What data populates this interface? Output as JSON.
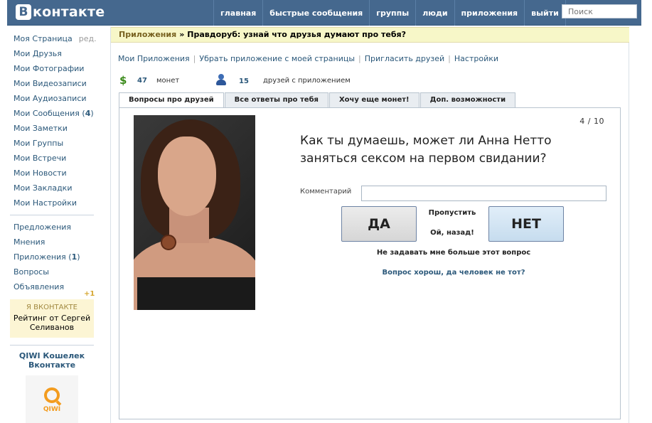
{
  "header": {
    "logo_mark": "В",
    "logo_text": "контакте",
    "nav": [
      "главная",
      "быстрые сообщения",
      "группы",
      "люди",
      "приложения",
      "выйти"
    ],
    "search_placeholder": "Поиск"
  },
  "sidebar": {
    "items": [
      {
        "label": "Моя Страница",
        "extra": "ред."
      },
      {
        "label": "Мои Друзья"
      },
      {
        "label": "Мои Фотографии"
      },
      {
        "label": "Мои Видеозаписи"
      },
      {
        "label": "Мои Аудиозаписи"
      },
      {
        "label": "Мои Сообщения",
        "count": "4"
      },
      {
        "label": "Мои Заметки"
      },
      {
        "label": "Мои Группы"
      },
      {
        "label": "Мои Встречи"
      },
      {
        "label": "Мои Новости"
      },
      {
        "label": "Мои Закладки"
      },
      {
        "label": "Мои Настройки"
      }
    ],
    "items2": [
      {
        "label": "Предложения"
      },
      {
        "label": "Мнения"
      },
      {
        "label": "Приложения",
        "count": "1"
      },
      {
        "label": "Вопросы"
      },
      {
        "label": "Объявления"
      }
    ],
    "plus": "+1",
    "ya_title": "Я ВКОНТАКТЕ",
    "ya_text": "Рейтинг от Сергей Селиванов",
    "qiwi_title": "QIWI Кошелек Вконтакте",
    "qiwi_word": "QIWI"
  },
  "main": {
    "breadcrumb": "Приложения",
    "breadcrumb_sep": "»",
    "page_title": "Правдоруб: узнай что друзья думают про тебя?",
    "actions": [
      "Мои Приложения",
      "Убрать приложение с моей страницы",
      "Пригласить друзей",
      "Настройки"
    ],
    "action_sep": "|",
    "coins": "47",
    "coins_label": "монет",
    "coin_symbol": "$",
    "friends": "15",
    "friends_label": "друзей с приложением",
    "tabs": [
      "Вопросы про друзей",
      "Все ответы про тебя",
      "Хочу еще монет!",
      "Доп. возможности"
    ],
    "counter": "4 / 10",
    "question": "Как ты думаешь, может ли Анна Нетто заняться сексом на первом свидании?",
    "comment_label": "Комментарий",
    "yes": "ДА",
    "no": "НЕТ",
    "skip": "Пропустить",
    "back": "Ой, назад!",
    "no_ask": "Не задавать мне больше этот вопрос",
    "good_q": "Вопрос хорош, да человек не тот?"
  },
  "colors": {
    "header_bg": "#45688e",
    "link": "#2b587a",
    "crumb_bg": "#f7f7c8"
  }
}
